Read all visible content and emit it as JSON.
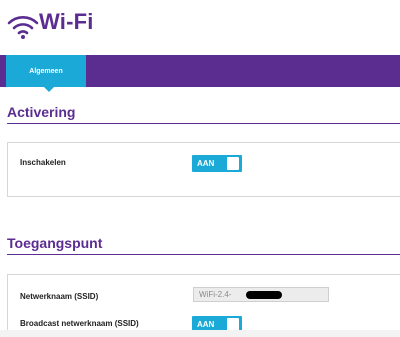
{
  "header": {
    "title": "Wi-Fi",
    "icon": "wifi-icon",
    "brand_color": "#5c2d91"
  },
  "tabs": [
    {
      "label": "Algemeen",
      "active": true
    }
  ],
  "colors": {
    "accent": "#1ba9d8",
    "tabbar": "#5c2d91"
  },
  "sections": {
    "activation": {
      "title": "Activering",
      "rows": [
        {
          "label": "Inschakelen",
          "toggle": "AAN"
        }
      ]
    },
    "access_point": {
      "title": "Toegangspunt",
      "rows": [
        {
          "label": "Netwerknaam (SSID)",
          "value": "WiFi-2.4-"
        },
        {
          "label": "Broadcast netwerknaam (SSID)",
          "toggle": "AAN"
        }
      ]
    }
  }
}
